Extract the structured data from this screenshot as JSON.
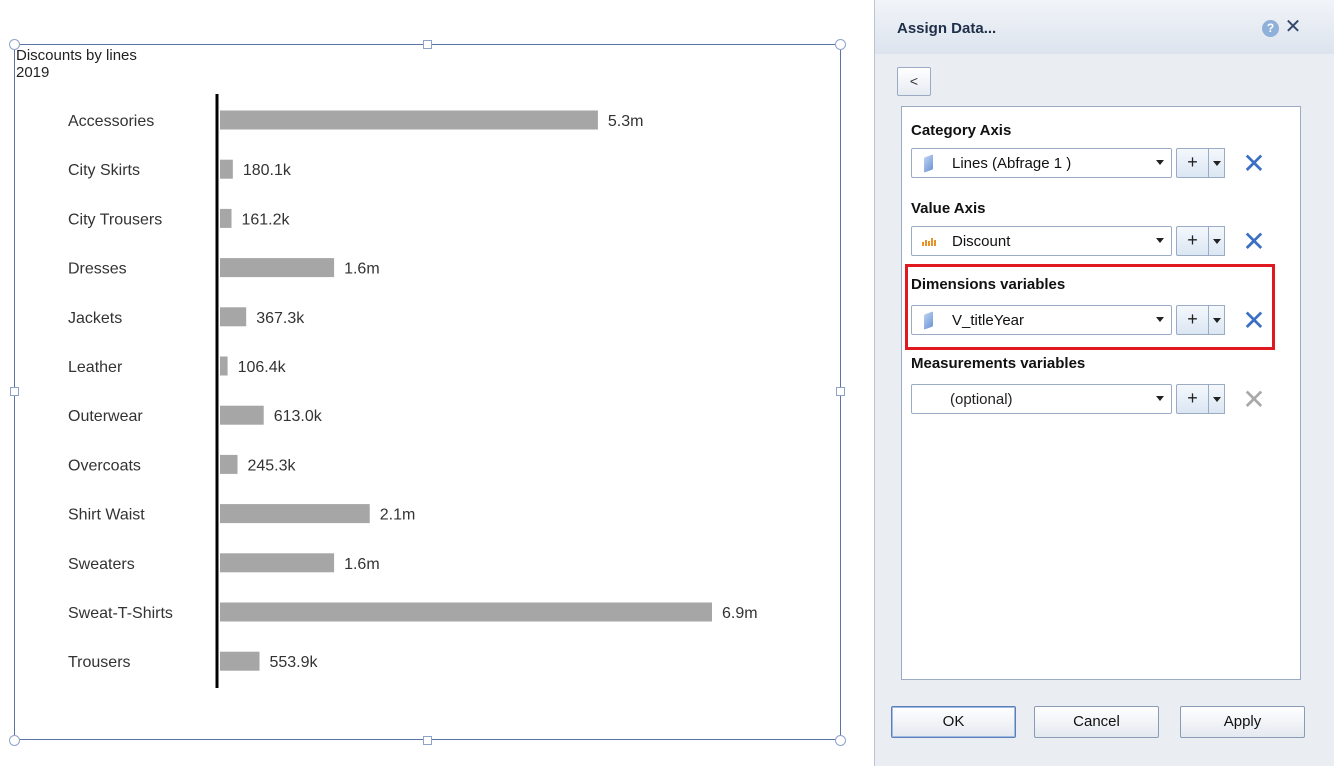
{
  "chart_data": {
    "type": "bar",
    "orientation": "horizontal",
    "title": "Discounts by lines",
    "subtitle": "2019",
    "categories": [
      "Accessories",
      "City Skirts",
      "City Trousers",
      "Dresses",
      "Jackets",
      "Leather",
      "Outerwear",
      "Overcoats",
      "Shirt Waist",
      "Sweaters",
      "Sweat-T-Shirts",
      "Trousers"
    ],
    "values": [
      5300000,
      180100,
      161200,
      1600000,
      367300,
      106400,
      613000,
      245300,
      2100000,
      1600000,
      6900000,
      553900
    ],
    "value_labels": [
      "5.3m",
      "180.1k",
      "161.2k",
      "1.6m",
      "367.3k",
      "106.4k",
      "613.0k",
      "245.3k",
      "2.1m",
      "1.6m",
      "6.9m",
      "553.9k"
    ],
    "bar_color": "#a6a6a6",
    "axis_color": "#000000",
    "grid": false,
    "legend": "none"
  },
  "dialog": {
    "title": "Assign Data...",
    "help_icon": "?",
    "close_icon": "✕",
    "back_label": "<",
    "category_axis": {
      "label": "Category Axis",
      "value": "Lines (Abfrage 1 )",
      "icon": "dimension-icon"
    },
    "value_axis": {
      "label": "Value Axis",
      "value": "Discount",
      "icon": "measure-icon"
    },
    "dimensions_variables": {
      "label": "Dimensions variables",
      "value": "V_titleYear",
      "icon": "dimension-icon"
    },
    "measurements_variables": {
      "label": "Measurements variables",
      "value": "(optional)"
    },
    "add_label": "+",
    "remove_label": "✕",
    "ok_label": "OK",
    "cancel_label": "Cancel",
    "apply_label": "Apply",
    "highlight_color": "#e01820"
  }
}
